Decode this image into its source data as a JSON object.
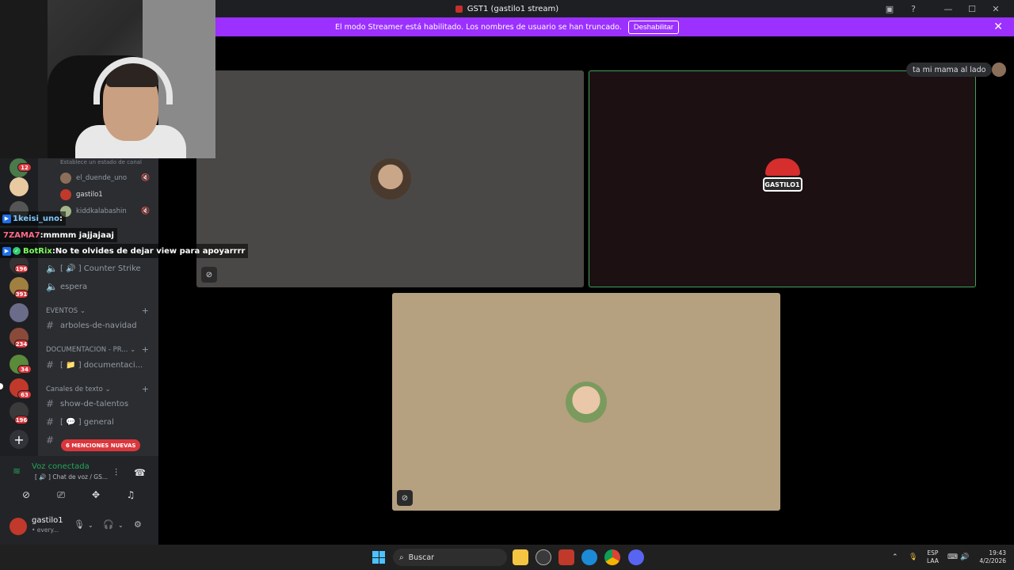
{
  "window": {
    "title": "GST1 (gastilo1 stream)"
  },
  "banner": {
    "text": "El modo Streamer está habilitado. Los nombres de usuario se han truncado.",
    "button": "Deshabilitar"
  },
  "server_rail": {
    "badges": [
      "12",
      "196",
      "391",
      "234",
      "34",
      "63",
      "196"
    ]
  },
  "channels": {
    "status_hint": "Establece un estado de canal",
    "voice_users": [
      "el_duende_uno",
      "gastilo1",
      "kiddkalabashin"
    ],
    "voice_channels": [
      "[ 🔊 ] Counter Strike",
      "espera"
    ],
    "categories": {
      "eventos": "EVENTOS",
      "documentacion": "DOCUMENTACION - PR...",
      "texto": "Canales de texto"
    },
    "text_channels": {
      "arboles": "arboles-de-navidad",
      "documentacion": "[ 📁 ] documentaci...",
      "talentos": "show-de-talentos",
      "general": "[ 💬 ] general"
    },
    "mentions": "6 MENCIONES NUEVAS"
  },
  "chat": [
    {
      "user": "1keisi_uno",
      "sep": " :",
      "message": "",
      "user_color": "#7ec8ff"
    },
    {
      "user": "7ZAMA7",
      "sep": " : ",
      "message": "mmmm jajjajaaj",
      "user_color": "#ff6b8a"
    },
    {
      "user": "BotRix",
      "sep": " : ",
      "message": "No te olvides de dejar view para apoyarrrr",
      "user_color": "#7cff5e"
    }
  ],
  "voice_panel": {
    "status": "Voz conectada",
    "channel": "[ 🔊 ] Chat de voz / GS..."
  },
  "user": {
    "name": "gastilo1",
    "sub": "• every..."
  },
  "call": {
    "notice": "ta mi mama al lado",
    "logo_text": "GASTILO1"
  },
  "taskbar": {
    "search": "Buscar",
    "lang1": "ESP",
    "lang2": "LAA",
    "time": "19:43",
    "date": "4/2/2026"
  },
  "colors": {
    "banner": "#9b30ff",
    "voice_connected": "#23a559",
    "speaking_border": "#3ba55c",
    "badge": "#da373c"
  }
}
